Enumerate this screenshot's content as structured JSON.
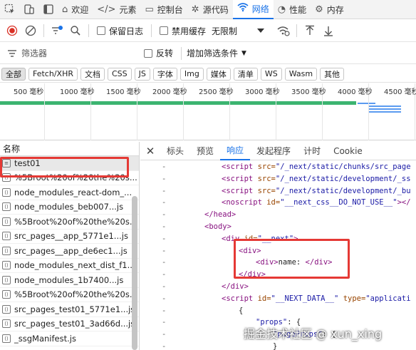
{
  "tabs": [
    {
      "label": "欢迎",
      "icon": "home-icon"
    },
    {
      "label": "元素",
      "icon": "code-icon"
    },
    {
      "label": "控制台",
      "icon": "console-icon"
    },
    {
      "label": "源代码",
      "icon": "bug-icon"
    },
    {
      "label": "网络",
      "icon": "wifi-icon"
    },
    {
      "label": "性能",
      "icon": "performance-icon"
    },
    {
      "label": "内存",
      "icon": "memory-icon"
    }
  ],
  "toolbar": {
    "preserve_log": "保留日志",
    "disable_cache": "禁用缓存",
    "throttling": "无限制"
  },
  "filter": {
    "placeholder": "筛选器",
    "invert": "反转",
    "more_filters": "增加筛选条件"
  },
  "type_filters": [
    "全部",
    "Fetch/XHR",
    "文档",
    "CSS",
    "JS",
    "字体",
    "Img",
    "媒体",
    "清单",
    "WS",
    "Wasm",
    "其他"
  ],
  "timeline": {
    "ticks": [
      "500 毫秒",
      "1000 毫秒",
      "1500 毫秒",
      "2000 毫秒",
      "2500 毫秒",
      "3000 毫秒",
      "3500 毫秒",
      "4000 毫秒",
      "4500 毫秒"
    ]
  },
  "requests": {
    "header": "名称",
    "items": [
      "test01",
      "%5Broot%20of%20the%20s...",
      "node_modules_react-dom_...",
      "node_modules_beb007...js",
      "%5Broot%20of%20the%20s...",
      "src_pages__app_5771e1...js",
      "src_pages__app_de6ec1...js",
      "node_modules_next_dist_f1...",
      "node_modules_1b7400...js",
      "%5Broot%20of%20the%20s...",
      "src_pages_test01_5771e1...js",
      "src_pages_test01_3ad66d...js",
      "_ssgManifest.js"
    ]
  },
  "detail_tabs": [
    "标头",
    "预览",
    "响应",
    "发起程序",
    "计时",
    "Cookie"
  ],
  "response_lines": [
    {
      "gutter": "-",
      "indent": 0,
      "parts": [
        [
          "tag",
          "<script "
        ],
        [
          "attr",
          "src="
        ],
        [
          "val",
          "\"/_next/static/chunks/src_page"
        ]
      ]
    },
    {
      "gutter": "-",
      "indent": 0,
      "parts": [
        [
          "tag",
          "<script "
        ],
        [
          "attr",
          "src="
        ],
        [
          "val",
          "\"/_next/static/development/_ss"
        ]
      ]
    },
    {
      "gutter": "-",
      "indent": 0,
      "parts": [
        [
          "tag",
          "<script "
        ],
        [
          "attr",
          "src="
        ],
        [
          "val",
          "\"/_next/static/development/_bu"
        ]
      ]
    },
    {
      "gutter": "-",
      "indent": 0,
      "parts": [
        [
          "tag",
          "<noscript "
        ],
        [
          "attr",
          "id="
        ],
        [
          "val",
          "\"__next_css__DO_NOT_USE__\""
        ],
        [
          "tag",
          "></"
        ]
      ]
    },
    {
      "gutter": "-",
      "indent": -1,
      "parts": [
        [
          "tag",
          "</head>"
        ]
      ]
    },
    {
      "gutter": "-",
      "indent": -1,
      "parts": [
        [
          "tag",
          "<body>"
        ]
      ]
    },
    {
      "gutter": "-",
      "indent": 0,
      "parts": [
        [
          "tag",
          "<div "
        ],
        [
          "attr",
          "id="
        ],
        [
          "val",
          "\"__next\""
        ],
        [
          "tag",
          ">"
        ]
      ]
    },
    {
      "gutter": "-",
      "indent": 1,
      "parts": [
        [
          "tag",
          "<div>"
        ]
      ]
    },
    {
      "gutter": "-",
      "indent": 2,
      "parts": [
        [
          "tag",
          "<div>"
        ],
        [
          "txt",
          "name: "
        ],
        [
          "tag",
          "</div>"
        ]
      ]
    },
    {
      "gutter": "-",
      "indent": 1,
      "parts": [
        [
          "tag",
          "</div>"
        ]
      ]
    },
    {
      "gutter": "-",
      "indent": 0,
      "parts": [
        [
          "tag",
          "</div>"
        ]
      ]
    },
    {
      "gutter": "-",
      "indent": 0,
      "parts": [
        [
          "tag",
          "<script "
        ],
        [
          "attr",
          "id="
        ],
        [
          "val",
          "\"__NEXT_DATA__\" "
        ],
        [
          "attr",
          "type="
        ],
        [
          "val",
          "\"applicati"
        ]
      ]
    },
    {
      "gutter": "-",
      "indent": 1,
      "parts": [
        [
          "txt",
          "{"
        ]
      ]
    },
    {
      "gutter": "-",
      "indent": 2,
      "parts": [
        [
          "val",
          "\"props\""
        ],
        [
          "txt",
          ": {"
        ]
      ]
    },
    {
      "gutter": "-",
      "indent": 3,
      "parts": [
        [
          "val",
          "\"pageProps\""
        ],
        [
          "txt",
          ": {"
        ]
      ]
    },
    {
      "gutter": "-",
      "indent": 3,
      "parts": [
        [
          "txt",
          "}"
        ]
      ]
    }
  ],
  "watermark": "掘金技术社区 @ xun_xing"
}
